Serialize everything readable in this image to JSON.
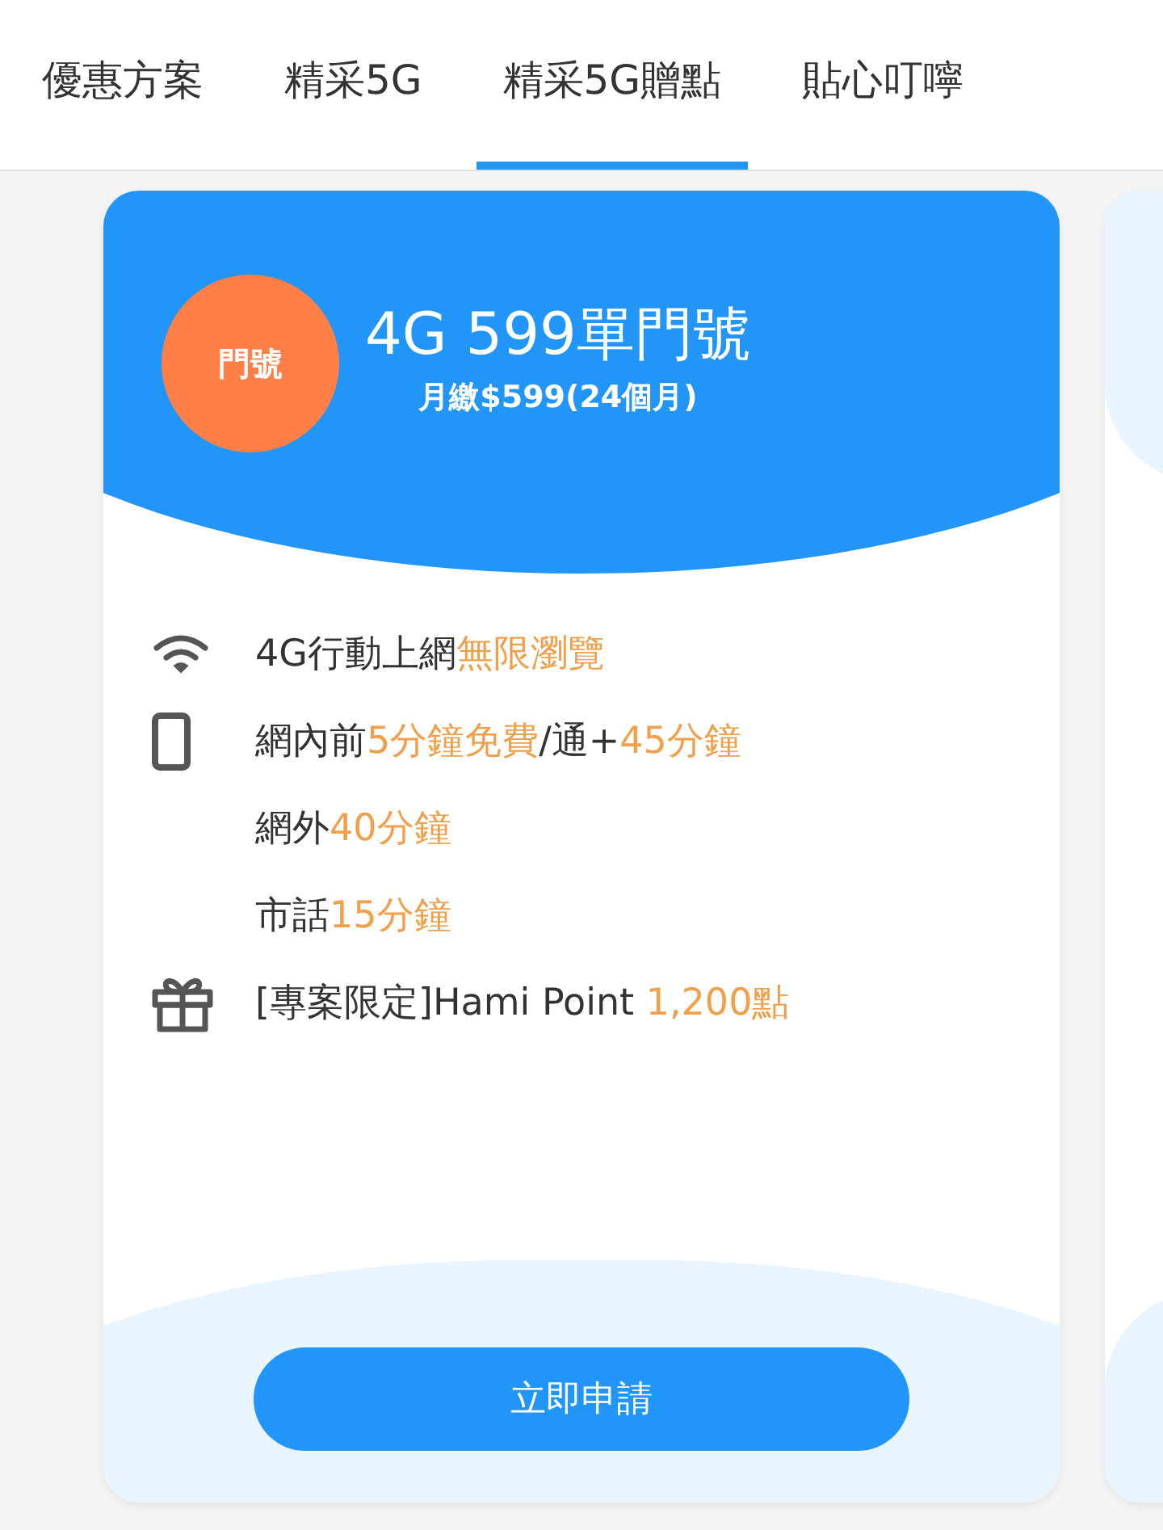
{
  "tabs": [
    {
      "label": "優惠方案",
      "selected": false
    },
    {
      "label": "精采5G",
      "selected": false
    },
    {
      "label": "精采5G贈點",
      "selected": true
    },
    {
      "label": "貼心叮嚀",
      "selected": false
    }
  ],
  "card": {
    "badge": "門號",
    "title": "4G 599單門號",
    "subtitle": "月繳$599(24個月)",
    "features": [
      {
        "kind": "wifi",
        "segments": [
          {
            "text": "4G行動上網",
            "highlight": false
          },
          {
            "text": "無限瀏覽",
            "highlight": true
          }
        ]
      },
      {
        "kind": "phone",
        "segments": [
          {
            "text": "網內前",
            "highlight": false
          },
          {
            "text": "5分鐘免費",
            "highlight": true
          },
          {
            "text": "/通+",
            "highlight": false
          },
          {
            "text": "45分鐘",
            "highlight": true
          }
        ]
      },
      {
        "kind": "none",
        "segments": [
          {
            "text": "網外",
            "highlight": false
          },
          {
            "text": "40分鐘",
            "highlight": true
          }
        ]
      },
      {
        "kind": "none",
        "segments": [
          {
            "text": "市話",
            "highlight": false
          },
          {
            "text": "15分鐘",
            "highlight": true
          }
        ]
      },
      {
        "kind": "gift",
        "segments": [
          {
            "text": "[專案限定]Hami Point ",
            "highlight": false
          },
          {
            "text": "1,200點",
            "highlight": true
          }
        ]
      }
    ],
    "button": "立即申請"
  }
}
